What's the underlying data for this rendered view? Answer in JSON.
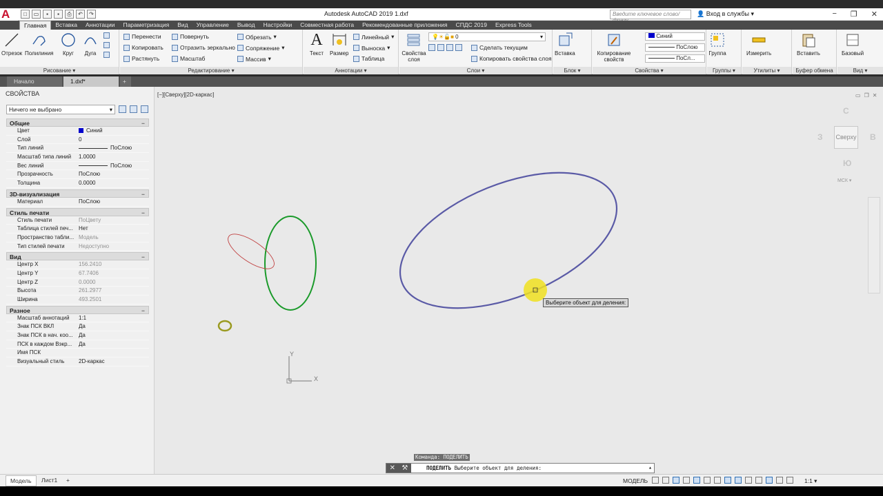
{
  "titlebar": {
    "app_title": "Autodesk AutoCAD 2019    1.dxf",
    "search_placeholder": "Введите ключевое слово/фразу",
    "signin_label": "Вход в службы"
  },
  "ribbon_tabs": [
    "Главная",
    "Вставка",
    "Аннотации",
    "Параметризация",
    "Вид",
    "Управление",
    "Вывод",
    "Настройки",
    "Совместная работа",
    "Рекомендованные приложения",
    "СПДС 2019",
    "Express Tools"
  ],
  "ribbon": {
    "draw": {
      "label": "Рисование ▾",
      "tools": [
        "Отрезок",
        "Полилиния",
        "Круг",
        "Дуга"
      ]
    },
    "modify": {
      "label": "Редактирование ▾",
      "tools": [
        "Перенести",
        "Повернуть",
        "Обрезать",
        "Копировать",
        "Отразить зеркально",
        "Сопряжение",
        "Растянуть",
        "Масштаб",
        "Массив"
      ]
    },
    "annotation": {
      "label": "Аннотации ▾",
      "text": "Текст",
      "dim": "Размер",
      "tools": [
        "Линейный",
        "Выноска",
        "Таблица"
      ]
    },
    "layers": {
      "label": "Слои ▾",
      "props_label": "Свойства слоя",
      "current_layer": "0",
      "make_current": "Сделать текущим",
      "match_layer": "Копировать свойства слоя"
    },
    "block": {
      "label": "Блок ▾",
      "insert": "Вставка"
    },
    "properties": {
      "label": "Свойства ▾",
      "match": "Копирование свойств",
      "color": "Синий",
      "linetype": "ПоСлою",
      "lineweight": "ПоСл..."
    },
    "groups": {
      "label": "Группы ▾",
      "tool": "Группа"
    },
    "utilities": {
      "label": "Утилиты ▾",
      "tool": "Измерить"
    },
    "clipboard": {
      "label": "Буфер обмена",
      "tool": "Вставить"
    },
    "view": {
      "label": "Вид ▾",
      "tool": "Базовый"
    }
  },
  "doc_tabs": [
    "Начало",
    "1.dxf*"
  ],
  "doc_tab_plus": "+",
  "properties_palette": {
    "title": "СВОЙСТВА",
    "selection": "Ничего не выбрано",
    "sections": [
      {
        "name": "Общие",
        "rows": [
          {
            "k": "Цвет",
            "v": "Синий",
            "swatch": "#0000cc"
          },
          {
            "k": "Слой",
            "v": "0"
          },
          {
            "k": "Тип линий",
            "v": "ПоСлою",
            "line": true
          },
          {
            "k": "Масштаб типа линий",
            "v": "1.0000"
          },
          {
            "k": "Вес линий",
            "v": "ПоСлою",
            "line": true
          },
          {
            "k": "Прозрачность",
            "v": "ПоСлою"
          },
          {
            "k": "Толщина",
            "v": "0.0000"
          }
        ]
      },
      {
        "name": "3D-визуализация",
        "rows": [
          {
            "k": "Материал",
            "v": "ПоСлою"
          }
        ]
      },
      {
        "name": "Стиль печати",
        "rows": [
          {
            "k": "Стиль печати",
            "v": "ПоЦвету",
            "dim": true
          },
          {
            "k": "Таблица стилей печ...",
            "v": "Нет"
          },
          {
            "k": "Пространство табли...",
            "v": "Модель",
            "dim": true
          },
          {
            "k": "Тип стилей печати",
            "v": "Недоступно",
            "dim": true
          }
        ]
      },
      {
        "name": "Вид",
        "rows": [
          {
            "k": "Центр X",
            "v": "156.2410",
            "dim": true
          },
          {
            "k": "Центр Y",
            "v": "67.7406",
            "dim": true
          },
          {
            "k": "Центр Z",
            "v": "0.0000",
            "dim": true
          },
          {
            "k": "Высота",
            "v": "261.2977",
            "dim": true
          },
          {
            "k": "Ширина",
            "v": "493.2501",
            "dim": true
          }
        ]
      },
      {
        "name": "Разное",
        "rows": [
          {
            "k": "Масштаб аннотаций",
            "v": "1:1"
          },
          {
            "k": "Знак ПСК ВКЛ",
            "v": "Да"
          },
          {
            "k": "Знак ПСК в нач. коо...",
            "v": "Да"
          },
          {
            "k": "ПСК в каждом Вэкр...",
            "v": "Да"
          },
          {
            "k": "Имя ПСК",
            "v": ""
          },
          {
            "k": "Визуальный стиль",
            "v": "2D-каркас"
          }
        ]
      }
    ]
  },
  "viewport": {
    "label": "[−][Сверху][2D-каркас]",
    "viewcube_face": "Сверху",
    "compass": {
      "n": "С",
      "s": "Ю",
      "w": "З",
      "e": "В"
    },
    "ucs_label": "МСК ▾",
    "ucs_x": "X",
    "ucs_y": "Y",
    "tooltip": "Выберите объект для деления:"
  },
  "command": {
    "history": "Команда: ПОДЕЛИТЬ",
    "prompt_cmd": "ПОДЕЛИТЬ",
    "prompt_text": "Выберите объект для деления:"
  },
  "statusbar": {
    "layout_tabs": [
      "Модель",
      "Лист1"
    ],
    "mode": "МОДЕЛЬ",
    "scale": "1:1 ▾"
  },
  "colors": {
    "ellipse_blue": "#5a5aa6",
    "ellipse_green": "#1a9a2a",
    "ellipse_red": "#c04040",
    "circle_olive": "#9a9a20",
    "cursor_highlight": "#f0e020"
  }
}
